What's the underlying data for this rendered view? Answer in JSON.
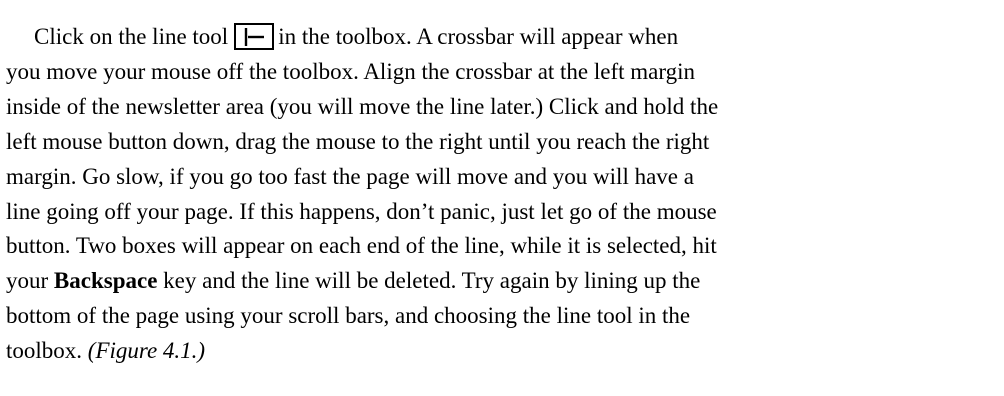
{
  "paragraph": {
    "line1_before_icon": "Click on the line tool",
    "line1_after_icon": "in the toolbox. A crossbar will appear when",
    "line2": "you move your mouse off the toolbox. Align the crossbar at the left margin",
    "line3": "inside of the newsletter area (you will move the line later.) Click and hold the",
    "line4": "left mouse button down, drag the mouse to the right until you reach the right",
    "line5": "margin. Go slow, if you go too fast the page will move and you will have a",
    "line6": "line going off your page. If this happens, don’t panic, just let go of the mouse",
    "line7": "button. Two boxes will appear on each end of the line, while it is selected, hit",
    "line8_before_bold": "your",
    "line8_bold": "Backspace",
    "line8_after_bold": "key and the line will be deleted. Try again by lining up the",
    "line9": "bottom of the page using your scroll bars, and choosing the line tool in the",
    "line10_before_italic": "toolbox.",
    "line10_italic": "(Figure 4.1.)"
  },
  "icons": {
    "line_tool": "line-tool-icon"
  }
}
